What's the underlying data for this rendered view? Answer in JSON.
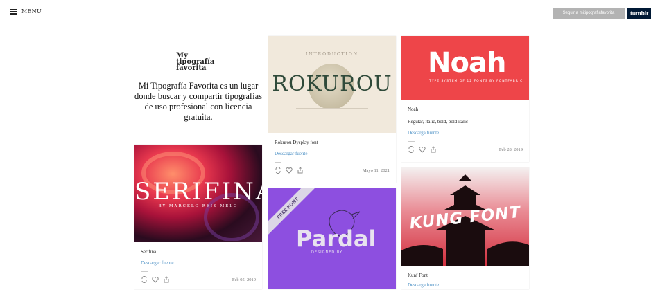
{
  "header": {
    "menu_label": "MENU",
    "follow_label": "Seguir a mitipografiafavorita",
    "tumblr_label": "tumblr"
  },
  "intro": {
    "logo_line1": "My",
    "logo_line2": "tipografía",
    "logo_line3": "favorita",
    "tagline": "Mi Tipografía Favorita es un lugar donde buscar y compartir tipografías de uso profesional con licencia gratuita."
  },
  "posts": [
    {
      "title": "Rokurou Dysplay font",
      "link": "Descargar fuente",
      "date": "Mayo 11, 2021",
      "image": {
        "overline": "INTRODUCTION",
        "word": "ROKUROU"
      }
    },
    {
      "title": "Noah",
      "subtitle": "Regular, italic, bold, bold italic",
      "link": "Descarga fuente",
      "date": "Feb 28, 2019",
      "image": {
        "word": "Noah",
        "small": "TYPE SYSTEM OF 12 FONTS BY FONTFABRIC"
      }
    },
    {
      "title": "Serifina",
      "link": "Descargar fuente",
      "date": "Feb 05, 2019",
      "image": {
        "word": "SERIFINA",
        "small": "BY MARCELO REIS MELO"
      }
    },
    {
      "image": {
        "ribbon": "FREE FONT",
        "word": "Pardal",
        "small": "DESIGNED BY"
      }
    },
    {
      "title": "Kunf Font",
      "link": "Descarga fuente",
      "image": {
        "word": "KUNG FONT"
      }
    }
  ],
  "icons": {
    "reblog": "reblog-icon",
    "like": "heart-icon",
    "share": "share-icon",
    "menu": "hamburger-icon"
  },
  "colors": {
    "link": "#4a8fc4",
    "tumblr_bg": "#001935",
    "follow_bg": "#b3b3b3",
    "noah_bg": "#ee4549",
    "pardal_bg": "#8d4fe0"
  }
}
